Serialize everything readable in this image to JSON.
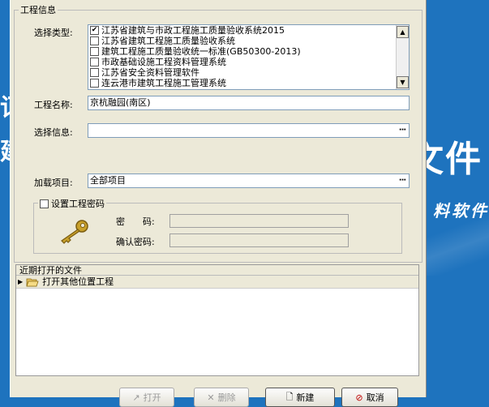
{
  "background": {
    "big_text": "文件",
    "small_text": "料软件",
    "left_text_1": "诃",
    "left_text_2": "建"
  },
  "project_info": {
    "group_title": "工程信息",
    "type_label": "选择类型:",
    "types": [
      {
        "label": "江苏省建筑与市政工程施工质量验收系统2015",
        "checked": true
      },
      {
        "label": "江苏省建筑工程施工质量验收系统",
        "checked": false
      },
      {
        "label": "建筑工程施工质量验收统一标准(GB50300-2013)",
        "checked": false
      },
      {
        "label": "市政基础设施工程资料管理系统",
        "checked": false
      },
      {
        "label": "江苏省安全资料管理软件",
        "checked": false
      },
      {
        "label": "连云港市建筑工程施工管理系统",
        "checked": false
      }
    ],
    "name_label": "工程名称:",
    "name_value": "京杭融园(南区)",
    "info_label": "选择信息:",
    "info_value": "",
    "load_label": "加载项目:",
    "load_value": "全部项目",
    "ellipsis": "···"
  },
  "password": {
    "group_title": "设置工程密码",
    "checked": false,
    "password_label": "密　　码:",
    "confirm_label": "确认密码:"
  },
  "recent": {
    "title": "近期打开的文件",
    "open_other": "打开其他位置工程"
  },
  "buttons": {
    "open": "打开",
    "delete": "删除",
    "new": "新建",
    "cancel": "取消"
  },
  "colors": {
    "background": "#1e73be",
    "dialog": "#ece9d8",
    "key_gold": "#c8a02a"
  }
}
